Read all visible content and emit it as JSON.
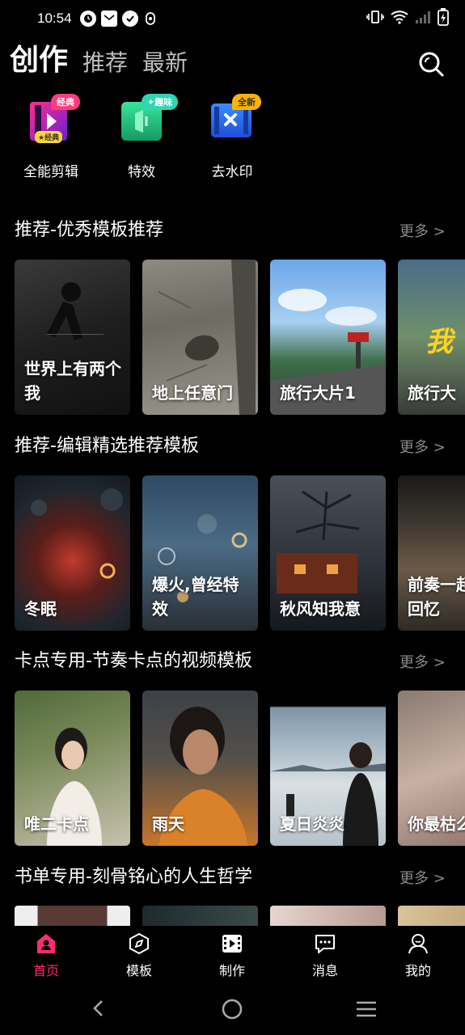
{
  "status": {
    "time": "10:54"
  },
  "top_tabs": [
    {
      "label": "创作",
      "active": true
    },
    {
      "label": "推荐",
      "active": false
    },
    {
      "label": "最新",
      "active": false
    }
  ],
  "shortcuts": [
    {
      "label": "全能剪辑",
      "badge": "经典",
      "sub_badge": "★经典",
      "icon": "film-edit-icon"
    },
    {
      "label": "特效",
      "badge": "✦趣味",
      "icon": "effects-icon"
    },
    {
      "label": "去水印",
      "badge": "全新",
      "icon": "remove-watermark-icon"
    }
  ],
  "sections": [
    {
      "title": "推荐-优秀模板推荐",
      "more": "更多 >",
      "cards": [
        "世界上有两个我",
        "地上任意门",
        "旅行大片1",
        "旅行大"
      ]
    },
    {
      "title": "推荐-编辑精选推荐模板",
      "more": "更多 >",
      "cards": [
        "冬眠",
        "爆火,曾经特效",
        "秋风知我意",
        "前奏一起多少回忆"
      ]
    },
    {
      "title": "卡点专用-节奏卡点的视频模板",
      "more": "更多 >",
      "cards": [
        "唯二卡点",
        "雨天",
        "夏日炎炎",
        "你最枯么"
      ]
    },
    {
      "title": "书单专用-刻骨铭心的人生哲学",
      "more": "更多 >"
    }
  ],
  "bottom_nav": [
    {
      "label": "首页",
      "icon": "home-icon",
      "active": true
    },
    {
      "label": "模板",
      "icon": "template-icon",
      "active": false
    },
    {
      "label": "制作",
      "icon": "make-video-icon",
      "active": false
    },
    {
      "label": "消息",
      "icon": "message-icon",
      "active": false
    },
    {
      "label": "我的",
      "icon": "profile-icon",
      "active": false
    }
  ],
  "colors": {
    "accent": "#ff2d6f",
    "background": "#000000"
  }
}
